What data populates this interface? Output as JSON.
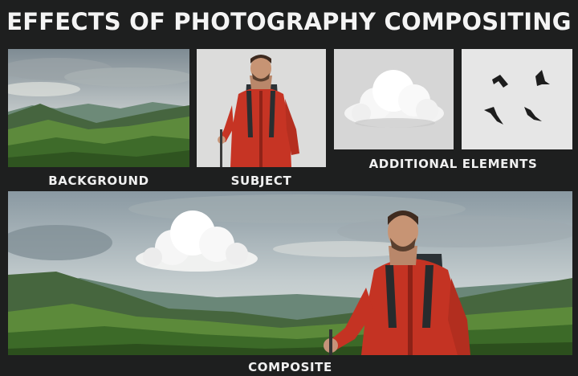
{
  "title": "EFFECTS OF PHOTOGRAPHY COMPOSITING",
  "panels": {
    "background": {
      "label": "BACKGROUND"
    },
    "subject": {
      "label": "SUBJECT"
    },
    "additional": {
      "label": "ADDITIONAL ELEMENTS"
    },
    "composite": {
      "label": "COMPOSITE"
    }
  },
  "colors": {
    "page_bg": "#1e1f1f",
    "sky": "#b9c4c8",
    "hill_green": "#4f7a3a",
    "jacket_red": "#c23423",
    "studio_grey": "#dcdcdc"
  }
}
